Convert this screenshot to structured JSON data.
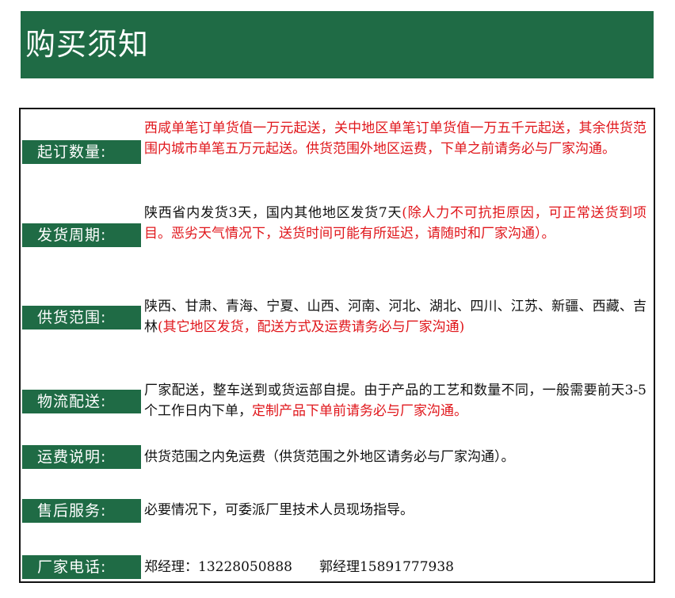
{
  "header": {
    "title": "购买须知"
  },
  "rows": {
    "order_qty": {
      "label": "起订数量:",
      "red": "西咸单笔订单货值一万元起送，关中地区单笔订单货值一万五千元起送，其余供货范围内城市单笔五万元起送。供货范围外地区运费，下单之前请务必与厂家沟通。"
    },
    "delivery_cycle": {
      "label": "发货周期:",
      "black": "陕西省内发货3天，国内其他地区发货7天",
      "red": "(除人力不可抗拒原因，可正常送货到项目。恶劣天气情况下，送货时间可能有所延迟，请随时和厂家沟通）。"
    },
    "supply_range": {
      "label": "供货范围:",
      "black": "陕西、甘肃、青海、宁夏、山西、河南、河北、湖北、四川、江苏、新疆、西藏、吉林",
      "red": "(其它地区发货，配送方式及运费请务必与厂家沟通)"
    },
    "logistics": {
      "label": "物流配送:",
      "black": "厂家配送，整车送到或货运部自提。由于产品的工艺和数量不同，一般需要前天3-5个工作日内下单，",
      "red": "定制产品下单前请务必与厂家沟通。"
    },
    "freight": {
      "label": "运费说明:",
      "black": "供货范围之内免运费（供货范围之外地区请务必与厂家沟通）。"
    },
    "after_sales": {
      "label": "售后服务:",
      "black": "必要情况下，可委派厂里技术人员现场指导。"
    },
    "phone": {
      "label": "厂家电话:",
      "contact1": "郑经理：13228050888",
      "contact2": "郭经理15891777938"
    }
  },
  "colors": {
    "brand_green": "#1f6b45",
    "accent_red": "#e0161b",
    "text": "#111111"
  }
}
